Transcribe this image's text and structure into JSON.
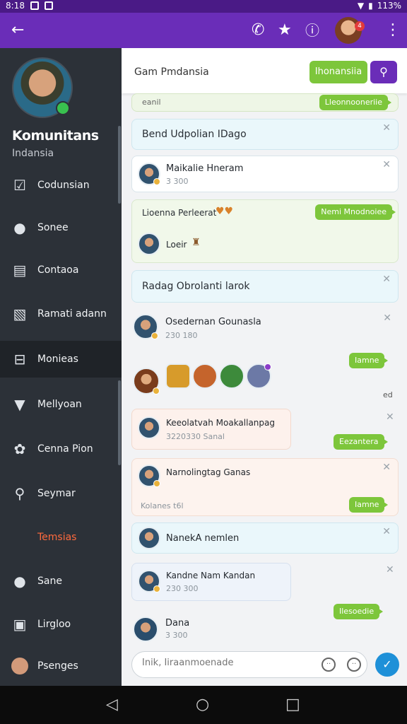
{
  "status_bar": {
    "time": "8:18",
    "battery": "113%"
  },
  "app_bar": {
    "notification_count": "4",
    "icons": [
      "back-arrow-icon",
      "phone-icon",
      "star-icon",
      "info-icon",
      "avatar",
      "more-vertical-icon"
    ]
  },
  "sidebar": {
    "title": "Komunitans",
    "subtitle": "Indansia",
    "items": [
      {
        "label": "Codunsian",
        "icon": "checkbox-icon"
      },
      {
        "label": "Sonee",
        "icon": "person-icon"
      },
      {
        "label": "Contaoa",
        "icon": "document-icon"
      },
      {
        "label": "Ramati adann",
        "icon": "image-icon"
      },
      {
        "label": "Monieas",
        "icon": "inbox-icon"
      },
      {
        "label": "Mellyoan",
        "icon": "filter-icon"
      },
      {
        "label": "Cenna Pion",
        "icon": "puzzle-icon"
      },
      {
        "label": "Seymar",
        "icon": "search-icon"
      },
      {
        "label": "Temsias",
        "icon": ""
      },
      {
        "label": "Sane",
        "icon": "person-icon"
      },
      {
        "label": "Lirgloo",
        "icon": "group-icon"
      },
      {
        "label": "Psenges",
        "icon": "avatar"
      }
    ]
  },
  "header": {
    "title": "Gam Pmdansia",
    "primary_button": "Ihonansiia",
    "search_icon": "search-person-icon"
  },
  "feed": {
    "partial_label": "eanil",
    "partial_pill": "Lleonnooneriie",
    "card1_title": "Bend Udpolian IDago",
    "card2_name": "Maikalie Hneram",
    "card2_meta": "3 300",
    "card3_title": "Lioenna Perleerat",
    "card3_pill": "Nemi Mnodnoiee",
    "card3_sub": "Loeir",
    "card4_title": "Radag Obrolanti larok",
    "card5_name": "Osedernan Gounasla",
    "card5_meta": "230 180",
    "pill_lanne1": "Iamne",
    "tiny_mark": "ed",
    "card6_name": "Keeolatvah Moakallanpag",
    "card6_meta": "3220330 Sanal",
    "pill_sanada": "Eezantera",
    "card7_name": "Narnolingtag Ganas",
    "card7_meta": "Kolanes t6l",
    "pill_lanne2": "Iamne",
    "card8_name": "NanekA nemlen",
    "card9_name": "Kandne Nam Kandan",
    "card9_meta": "230 300",
    "pill_last": "Ilesoedie",
    "card10_name": "Dana",
    "card10_meta": "3 300"
  },
  "composer": {
    "placeholder": "Inik, Iiraanmoenade"
  },
  "colors": {
    "appbar": "#6a2db8",
    "sidebar": "#2c3138",
    "accent_green": "#7dc63b",
    "accent_orange": "#ff6a3d",
    "send": "#1e90d8"
  }
}
